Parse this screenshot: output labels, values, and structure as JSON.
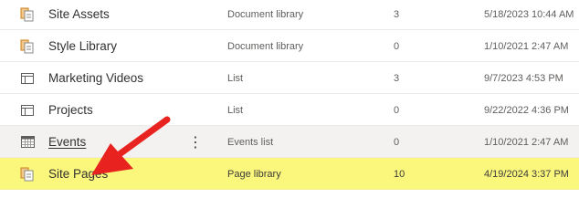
{
  "rows": [
    {
      "name": "Site Assets",
      "type": "Document library",
      "count": "3",
      "modified": "5/18/2023 10:44 AM",
      "icon": "document-library-icon"
    },
    {
      "name": "Style Library",
      "type": "Document library",
      "count": "0",
      "modified": "1/10/2021 2:47 AM",
      "icon": "document-library-icon"
    },
    {
      "name": "Marketing Videos",
      "type": "List",
      "count": "3",
      "modified": "9/7/2023 4:53 PM",
      "icon": "list-icon"
    },
    {
      "name": "Projects",
      "type": "List",
      "count": "0",
      "modified": "9/22/2022 4:36 PM",
      "icon": "list-icon"
    },
    {
      "name": "Events",
      "type": "Events list",
      "count": "0",
      "modified": "1/10/2021 2:47 AM",
      "icon": "calendar-icon",
      "more": "⋮"
    },
    {
      "name": "Site Pages",
      "type": "Page library",
      "count": "10",
      "modified": "4/19/2024 3:37 PM",
      "icon": "document-library-icon"
    }
  ],
  "colors": {
    "highlight": "#fbf77c",
    "hover_row": "#f3f2f1",
    "annotation_arrow": "#e8231f",
    "library_icon": "#e8a33d"
  }
}
